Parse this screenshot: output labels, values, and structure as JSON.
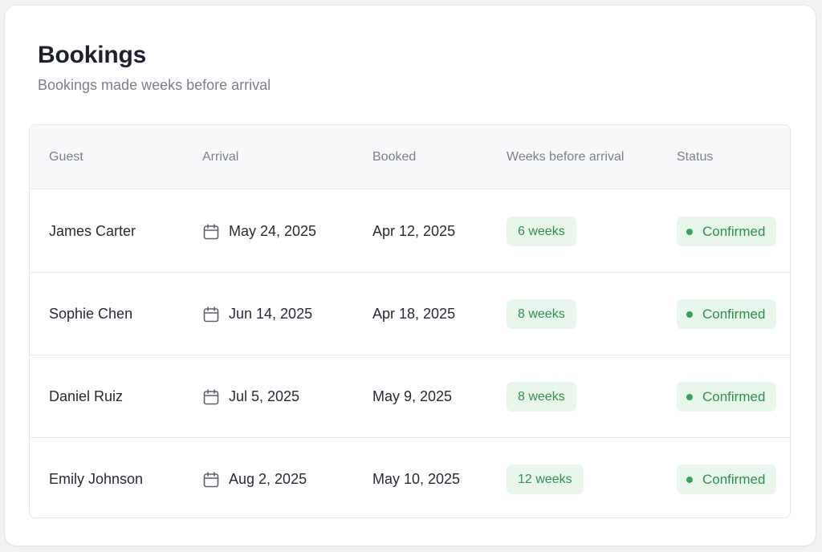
{
  "header": {
    "title": "Bookings",
    "subtitle": "Bookings made weeks before arrival"
  },
  "table": {
    "columns": [
      "Guest",
      "Arrival",
      "Booked",
      "Weeks before arrival",
      "Status"
    ],
    "rows": [
      {
        "guest": "James Carter",
        "arrival": "May 24, 2025",
        "booked": "Apr 12, 2025",
        "weeks": "6 weeks",
        "status": "Confirmed"
      },
      {
        "guest": "Sophie Chen",
        "arrival": "Jun 14, 2025",
        "booked": "Apr 18, 2025",
        "weeks": "8 weeks",
        "status": "Confirmed"
      },
      {
        "guest": "Daniel Ruiz",
        "arrival": "Jul 5, 2025",
        "booked": "May 9, 2025",
        "weeks": "8 weeks",
        "status": "Confirmed"
      },
      {
        "guest": "Emily Johnson",
        "arrival": "Aug 2, 2025",
        "booked": "May 10, 2025",
        "weeks": "12 weeks",
        "status": "Confirmed"
      }
    ]
  },
  "icons": {
    "arrival": "calendar-icon",
    "status": "status-dot"
  },
  "colors": {
    "accent_green": "#2f8f4e",
    "pill_bg": "#e9f6ec",
    "title": "#1b2130"
  }
}
